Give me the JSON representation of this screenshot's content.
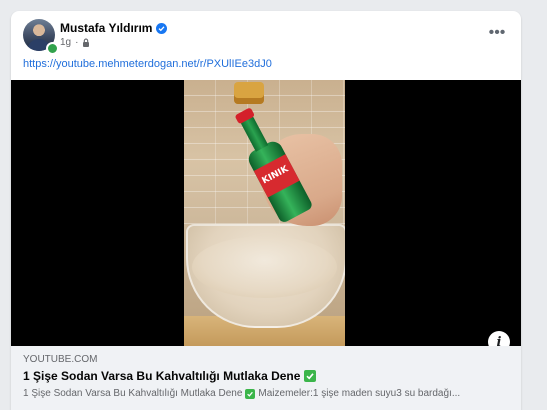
{
  "post": {
    "author_name": "Mustafa Yıldırım",
    "timestamp": "1g",
    "privacy_icon": "lock-icon",
    "verified_icon": "verified-badge-icon",
    "more_label": "•••",
    "link_text": "https://youtube.mehmeterdogan.net/r/PXUlIEe3dJ0"
  },
  "media": {
    "bottle_label": "KINIK",
    "info_label": "i"
  },
  "link_preview": {
    "domain": "YOUTUBE.COM",
    "title": "1 Şişe Sodan Varsa Bu Kahvaltılığı Mutlaka Dene",
    "description_prefix": "1 Şişe Sodan Varsa Bu Kahvaltılığı Mutlaka Dene",
    "description_suffix": "Maizemeler:1 şişe maden suyu3 su bardağı..."
  },
  "colors": {
    "link": "#216fdb",
    "verified": "#1877f2",
    "online": "#31a24c",
    "check_emoji": "#3bb54a"
  }
}
